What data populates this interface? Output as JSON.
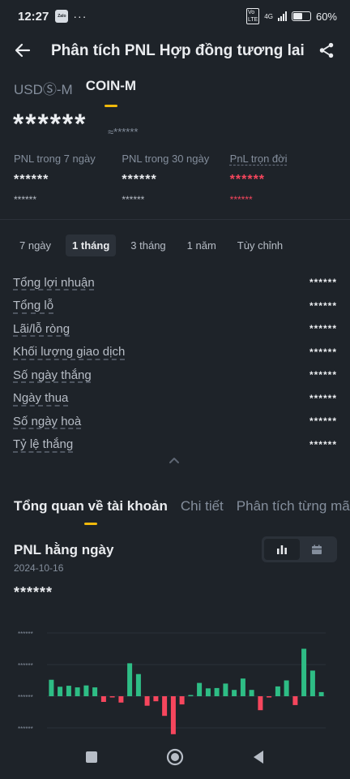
{
  "status_bar": {
    "time": "12:27",
    "app_icon": "Zalo",
    "dots": "···",
    "network": "4G",
    "battery": "60%",
    "battery_level": 0.6
  },
  "header": {
    "title": "Phân tích PNL Hợp đồng tương lai",
    "back_icon": "back-arrow-icon",
    "share_icon": "share-icon"
  },
  "account_tabs": [
    {
      "label": "USDⓈ-M",
      "active": false
    },
    {
      "label": "COIN-M",
      "active": true
    }
  ],
  "balance": {
    "value": "******",
    "sub": "≈******"
  },
  "pnl_summary": [
    {
      "label": "PNL trong 7 ngày",
      "value": "******",
      "sub": "******"
    },
    {
      "label": "PNL trong 30 ngày",
      "value": "******",
      "sub": "******"
    },
    {
      "label": "PnL trọn đời",
      "value": "******",
      "sub": "******"
    }
  ],
  "periods": [
    "7 ngày",
    "1 tháng",
    "3 tháng",
    "1 năm",
    "Tùy chỉnh"
  ],
  "active_period": "1 tháng",
  "metrics": [
    {
      "label": "Tổng lợi nhuận",
      "value": "******"
    },
    {
      "label": "Tổng lỗ",
      "value": "******"
    },
    {
      "label": "Lãi/lỗ ròng",
      "value": "******"
    },
    {
      "label": "Khối lượng giao dịch",
      "value": "******"
    },
    {
      "label": "Số ngày thắng",
      "value": "******"
    },
    {
      "label": "Ngày thua",
      "value": "******"
    },
    {
      "label": "Số ngày hoà",
      "value": "******"
    },
    {
      "label": "Tỷ lệ thắng",
      "value": "******"
    }
  ],
  "section_tabs": [
    {
      "label": "Tổng quan về tài khoản",
      "active": true
    },
    {
      "label": "Chi tiết",
      "active": false
    },
    {
      "label": "Phân tích từng mã",
      "active": false
    }
  ],
  "chart_section": {
    "title": "PNL hằng ngày",
    "date": "2024-10-16",
    "value": "******"
  },
  "colors": {
    "background": "#1e2329",
    "accent": "#f0b90b",
    "positive": "#2ebd85",
    "negative": "#f6465d",
    "muted": "#848e9c"
  },
  "chart_data": {
    "type": "bar",
    "title": "PNL hằng ngày",
    "ytick_labels": [
      "******",
      "******",
      "******",
      "******"
    ],
    "grid": true,
    "values": [
      0.52,
      0.3,
      0.33,
      0.28,
      0.34,
      0.28,
      -0.18,
      -0.03,
      -0.2,
      1.04,
      0.7,
      -0.3,
      -0.16,
      -0.62,
      -1.2,
      -0.26,
      0.03,
      0.42,
      0.25,
      0.26,
      0.4,
      0.2,
      0.56,
      0.2,
      -0.44,
      -0.03,
      0.31,
      0.5,
      -0.28,
      1.5,
      0.81,
      0.13
    ]
  }
}
